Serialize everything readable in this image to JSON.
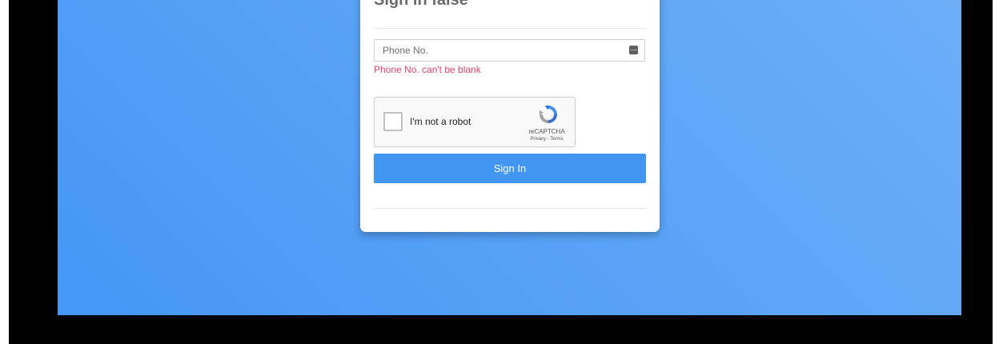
{
  "form": {
    "title": "Sign in false",
    "phone_placeholder": "Phone No.",
    "phone_value": "",
    "error_message": "Phone No. can't be blank",
    "submit_label": "Sign In"
  },
  "recaptcha": {
    "label": "I'm not a robot",
    "brand": "reCAPTCHA",
    "privacy_label": "Privacy",
    "separator": " - ",
    "terms_label": "Terms",
    "checked": false
  },
  "icons": {
    "input_icon": "autofill-icon",
    "recaptcha_icon": "recaptcha-logo-icon"
  },
  "colors": {
    "background_gradient_start": "#6daef7",
    "background_gradient_end": "#4597f6",
    "error": "#e8436a",
    "button": "#4196f1",
    "title": "#6b6b6b",
    "frame": "#000000"
  }
}
